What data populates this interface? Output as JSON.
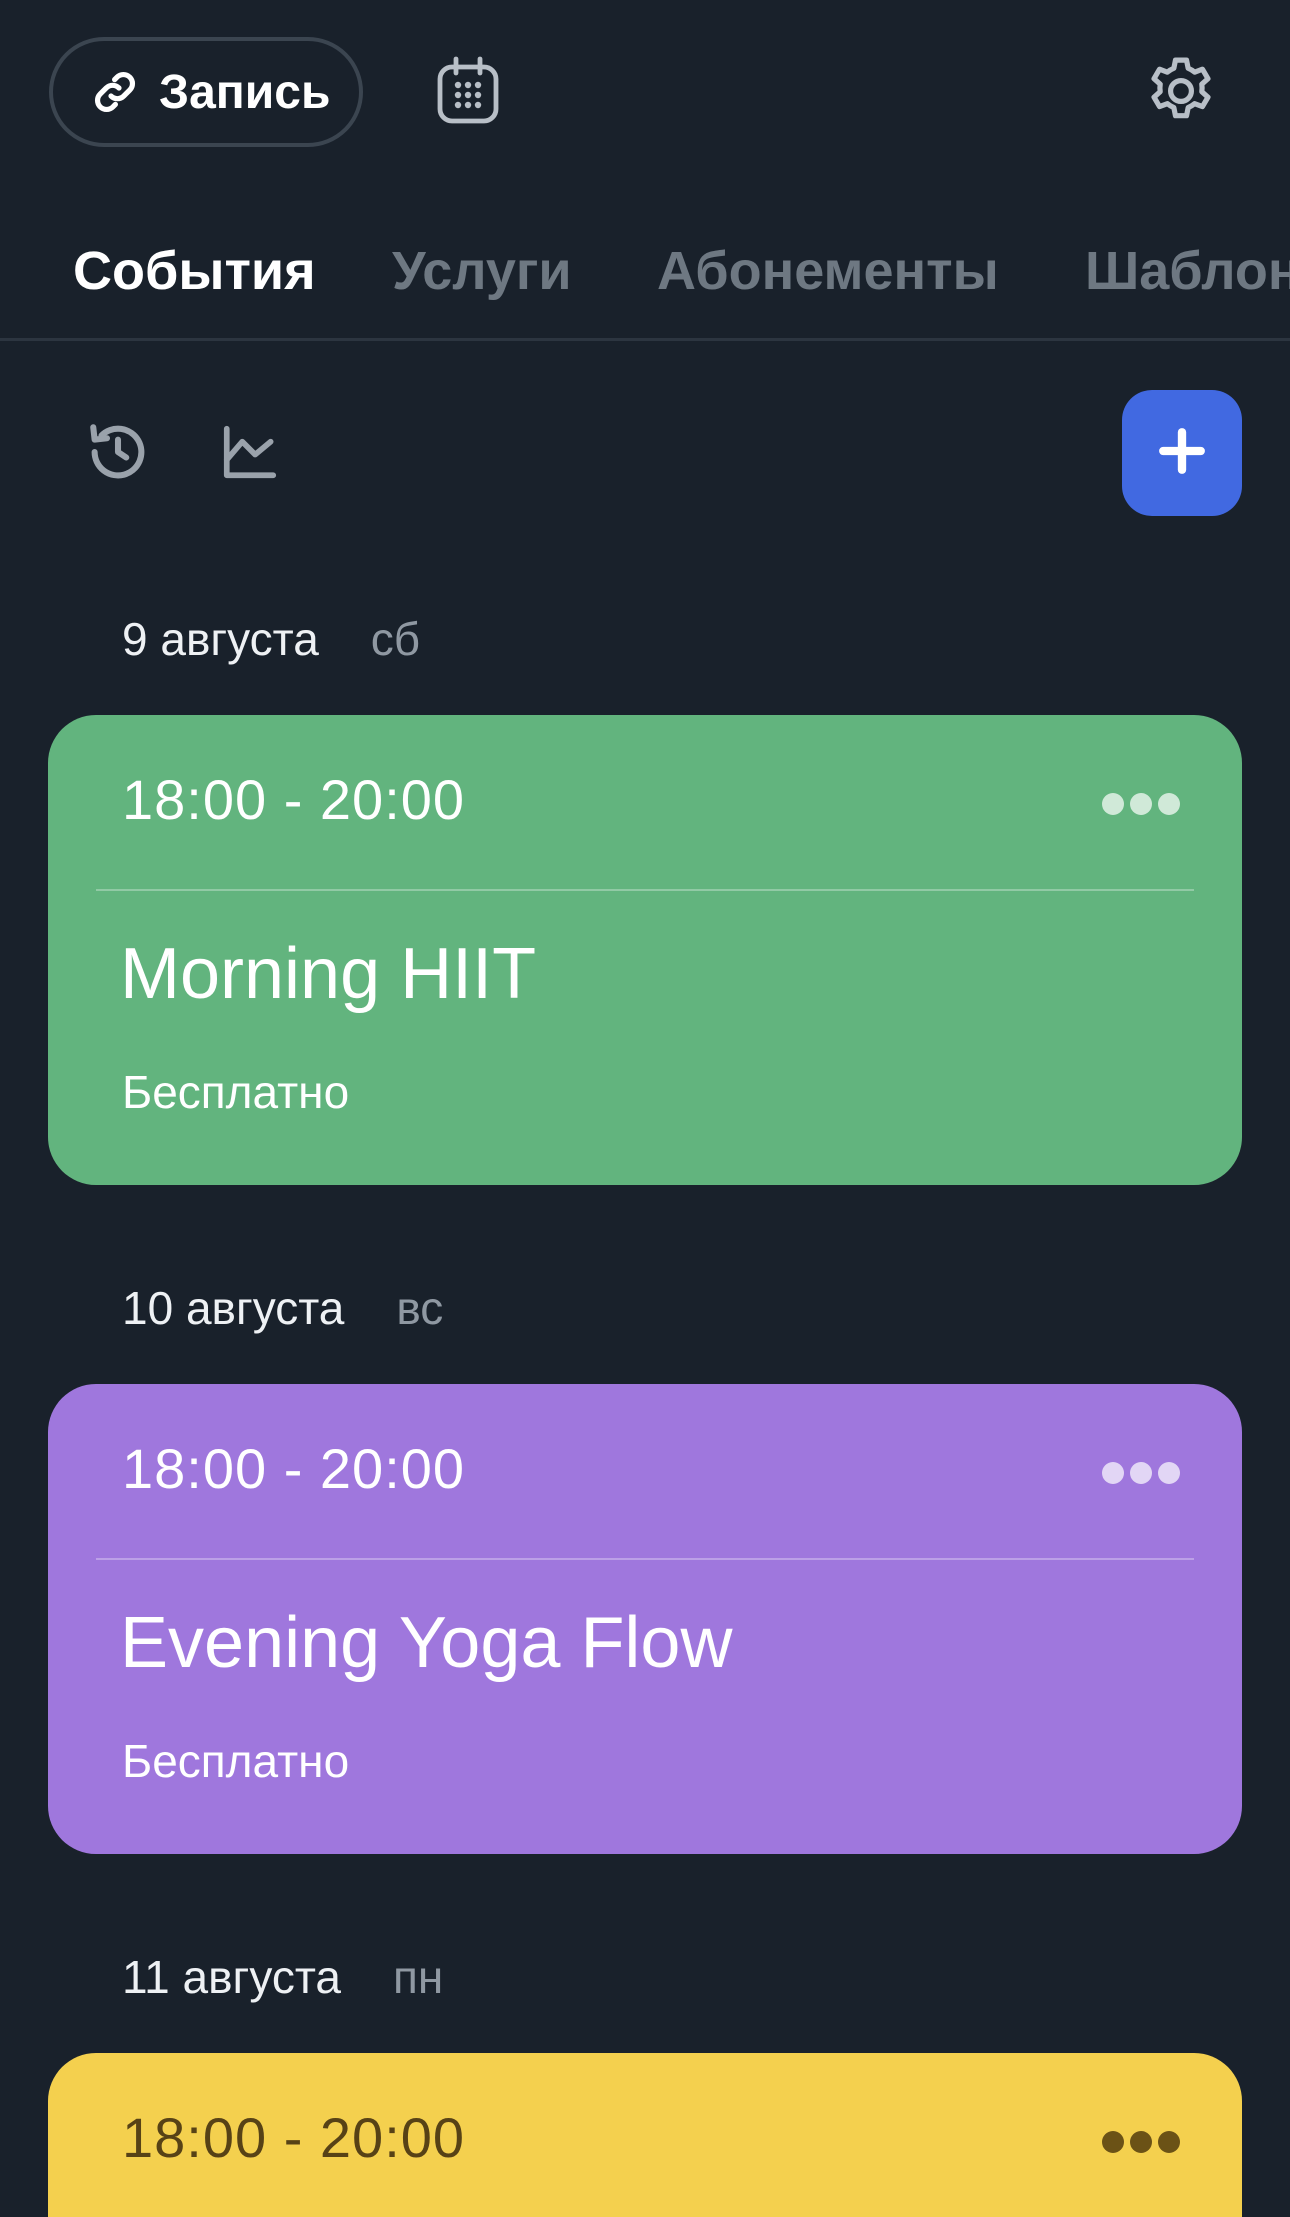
{
  "header": {
    "link_button_label": "Запись",
    "link_icon": "link-icon",
    "calendar_icon": "calendar-icon",
    "settings_icon": "gear-icon"
  },
  "tabs": [
    {
      "label": "События",
      "active": true
    },
    {
      "label": "Услуги",
      "active": false
    },
    {
      "label": "Абонементы",
      "active": false
    },
    {
      "label": "Шаблоны",
      "active": false
    }
  ],
  "toolbar": {
    "history_icon": "history-icon",
    "stats_icon": "chart-icon",
    "add_label": "+",
    "add_color": "#4169e1"
  },
  "events": [
    {
      "date": "9 августа",
      "dow": "сб",
      "time": "18:00 - 20:00",
      "title": "Morning HIIT",
      "price": "Бесплатно",
      "color": "#62b47e"
    },
    {
      "date": "10 августа",
      "dow": "вс",
      "time": "18:00 - 20:00",
      "title": "Evening Yoga Flow",
      "price": "Бесплатно",
      "color": "#9f77dd"
    },
    {
      "date": "11 августа",
      "dow": "пн",
      "time": "18:00 - 20:00",
      "color": "#f4d04e"
    }
  ]
}
